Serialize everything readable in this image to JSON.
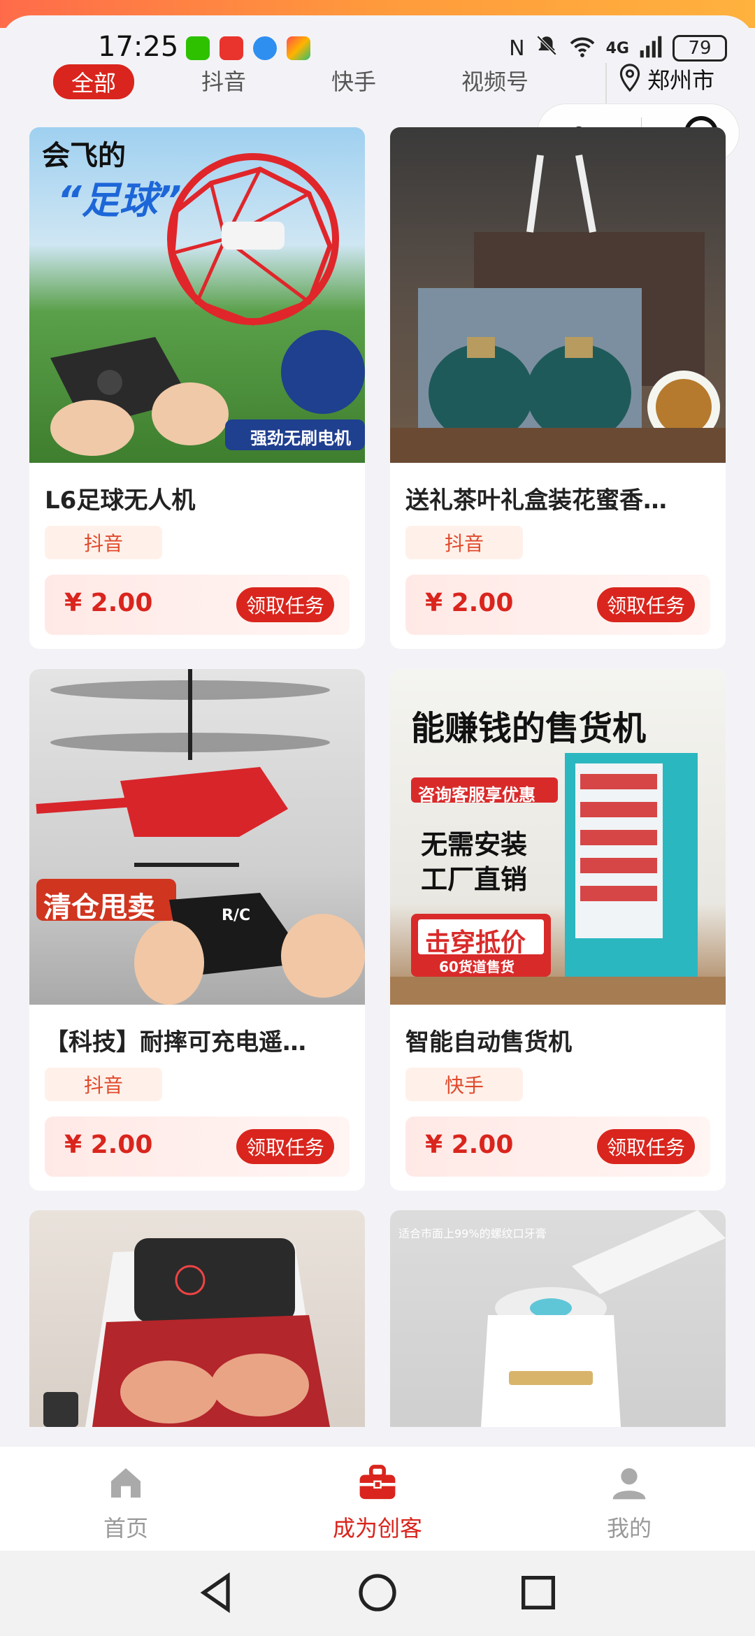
{
  "status": {
    "time": "17:25",
    "battery": "79",
    "network": "4G"
  },
  "tabs": [
    {
      "label": "全部",
      "active": true
    },
    {
      "label": "抖音",
      "active": false
    },
    {
      "label": "快手",
      "active": false
    },
    {
      "label": "视频号",
      "active": false
    }
  ],
  "location": {
    "city": "郑州市"
  },
  "products": [
    {
      "title": "L6足球无人机",
      "platform": "抖音",
      "price": "¥ 2.00",
      "button": "领取任务",
      "image_text": [
        "会飞的",
        "“足球”",
        "强劲无刷电机"
      ]
    },
    {
      "title": "送礼茶叶礼盒装花蜜香…",
      "platform": "抖音",
      "price": "¥ 2.00",
      "button": "领取任务",
      "image_text": []
    },
    {
      "title": "【科技】耐摔可充电遥…",
      "platform": "抖音",
      "price": "¥ 2.00",
      "button": "领取任务",
      "image_text": [
        "清仓甩卖",
        "R/C"
      ]
    },
    {
      "title": "智能自动售货机",
      "platform": "快手",
      "price": "¥ 2.00",
      "button": "领取任务",
      "image_text": [
        "能赚钱的售货机",
        "咨询客服享优惠",
        "无需安装",
        "工厂直销",
        "击穿抵价",
        "60货道售货"
      ]
    },
    {
      "title": "",
      "platform": "",
      "price": "",
      "button": "",
      "image_text": []
    },
    {
      "title": "",
      "platform": "",
      "price": "",
      "button": "",
      "image_text": [
        "适合市面上99%的螺纹口牙膏"
      ]
    }
  ],
  "bottom_nav": [
    {
      "label": "首页",
      "icon": "home-icon",
      "active": false
    },
    {
      "label": "成为创客",
      "icon": "briefcase-icon",
      "active": true
    },
    {
      "label": "我的",
      "icon": "user-icon",
      "active": false
    }
  ],
  "colors": {
    "accent": "#d9251d",
    "tag_bg": "#fff1ea",
    "tag_text": "#e0492b"
  }
}
